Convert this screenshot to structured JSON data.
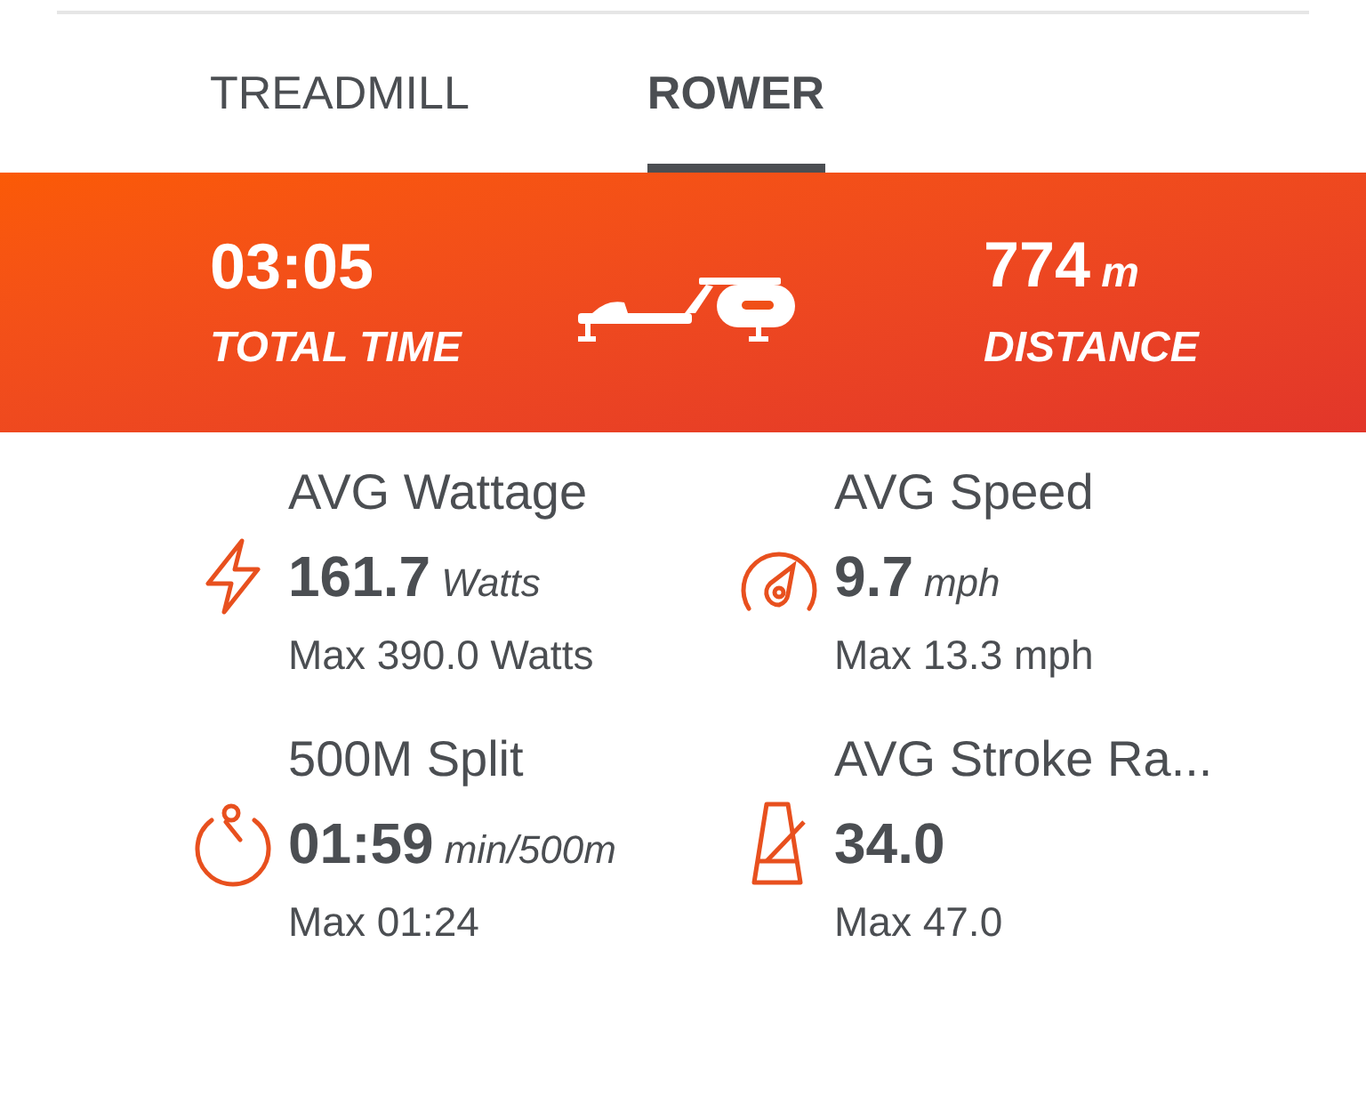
{
  "tabs": [
    {
      "label": "TREADMILL",
      "selected": false
    },
    {
      "label": "ROWER",
      "selected": true
    }
  ],
  "summary": {
    "left": {
      "value": "03:05",
      "label": "TOTAL TIME"
    },
    "right": {
      "value": "774",
      "unit": "m",
      "label": "DISTANCE"
    }
  },
  "metrics": [
    {
      "title": "AVG Wattage",
      "value": "161.7",
      "unit": "Watts",
      "max": "Max 390.0 Watts"
    },
    {
      "title": "AVG Speed",
      "value": "9.7",
      "unit": "mph",
      "max": "Max 13.3 mph"
    },
    {
      "title": "500M Split",
      "value": "01:59",
      "unit": "min/500m",
      "max": "Max 01:24"
    },
    {
      "title": "AVG Stroke Ra...",
      "value": "34.0",
      "max": "Max 47.0"
    }
  ]
}
